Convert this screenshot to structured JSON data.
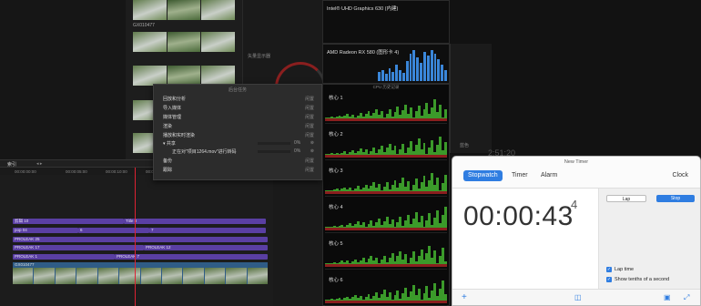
{
  "browser": {
    "clip_name": "GX010477"
  },
  "viewer": {
    "label": "矢量显示器"
  },
  "gpu": [
    {
      "name": "Intel® UHD Graphics 630 (内建)"
    },
    {
      "name": "AMD Radeon RX 580 (图形卡 4)"
    }
  ],
  "cpu": {
    "header": "CPU 历史记录",
    "cores": [
      "核心 1",
      "核心 2",
      "核心 3",
      "核心 4",
      "核心 5",
      "核心 6"
    ]
  },
  "popup": {
    "title": "后台任务",
    "rows": [
      {
        "label": "回放和分析",
        "status": "闲置"
      },
      {
        "label": "导入媒体",
        "status": "闲置"
      },
      {
        "label": "媒体管理",
        "status": "闲置"
      },
      {
        "label": "渲染",
        "status": "闲置"
      },
      {
        "label": "播放和实时渲染",
        "status": "闲置"
      }
    ],
    "share": {
      "label": "共享",
      "percent": "0%"
    },
    "share_item": {
      "label": "正在对\"项目1264.mov\"进行转码",
      "percent": "0%"
    },
    "tail_rows": [
      {
        "label": "备份",
        "status": "闲置"
      },
      {
        "label": "跟踪",
        "status": "闲置"
      }
    ]
  },
  "timeline": {
    "index_label": "索引",
    "timecodes": [
      "00:00:00:00",
      "00:00:05:00",
      "00:00:10:00",
      "00:00:15:00"
    ],
    "tracks": [
      {
        "label": "剪辑 10"
      },
      {
        "label": "Title 8"
      },
      {
        "label": "pop 04"
      },
      {
        "label": "6"
      },
      {
        "label": "7"
      },
      {
        "label": "PROLEAK 25"
      },
      {
        "label": "PROLEAK 17"
      },
      {
        "label": "PROLEAK 12"
      },
      {
        "label": "PROLEAK 1"
      },
      {
        "label": "PROLEAK 7"
      }
    ],
    "video_clip": "GX010477"
  },
  "right": {
    "timecode": "2:51:20",
    "label": "蓝色"
  },
  "timer": {
    "window_title": "New Timer",
    "tabs": [
      "Stopwatch",
      "Timer",
      "Alarm",
      "Clock"
    ],
    "time": "00:00:43",
    "tenths": "4",
    "lap_label": "Lap",
    "stop_label": "Stop",
    "options": [
      "Lap time",
      "Show tenths of a second"
    ],
    "accent": "#2f7de1"
  }
}
